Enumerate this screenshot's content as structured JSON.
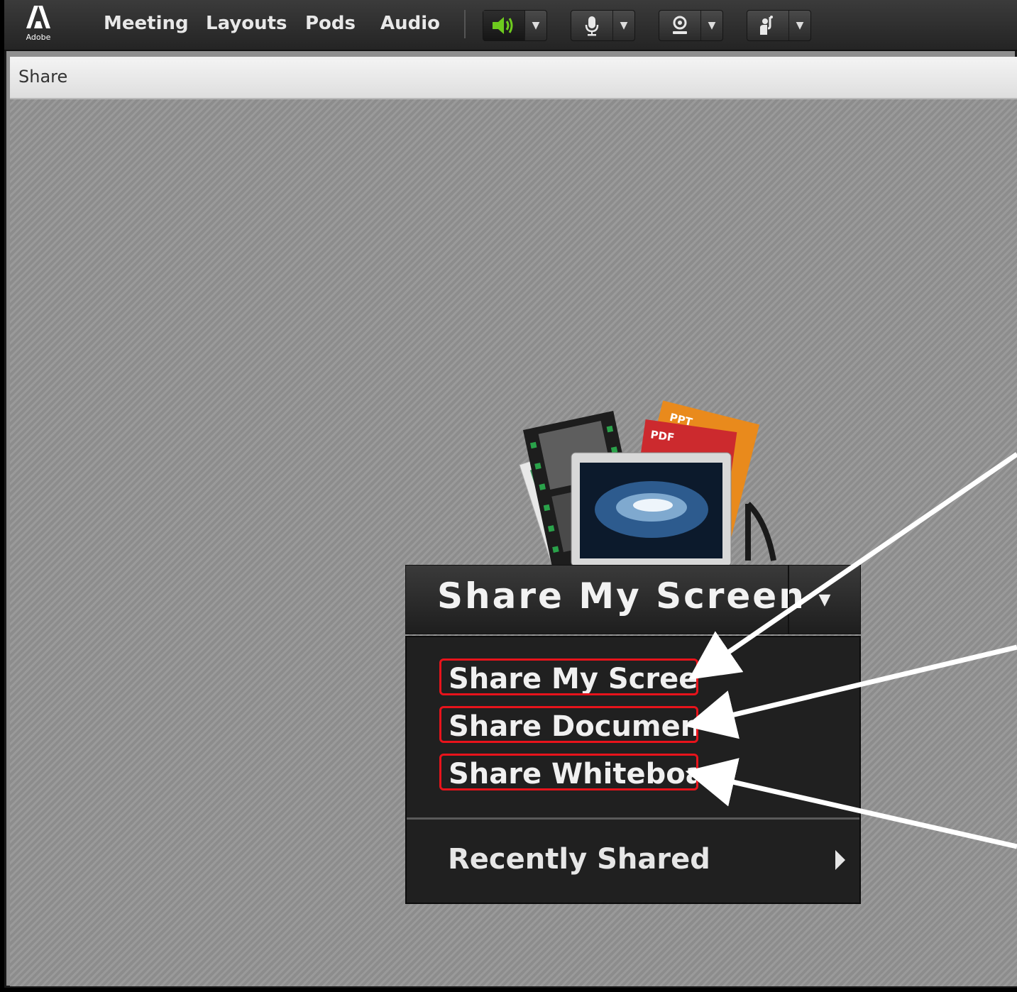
{
  "app": {
    "logo_text": "Adobe"
  },
  "menubar": {
    "items": [
      "Meeting",
      "Layouts",
      "Pods",
      "Audio"
    ],
    "tools": [
      {
        "icon": "speaker-icon",
        "active": true,
        "color": "#6ecb1e"
      },
      {
        "icon": "microphone-icon",
        "active": false
      },
      {
        "icon": "webcam-icon",
        "active": false
      },
      {
        "icon": "raise-hand-icon",
        "active": false
      }
    ]
  },
  "pod": {
    "title": "Share"
  },
  "share_button": {
    "label": "Share My Screen"
  },
  "dropdown": {
    "items": [
      "Share My Screen",
      "Share Document",
      "Share Whiteboard"
    ],
    "recent": "Recently Shared"
  },
  "media_icon": {
    "doc_labels": [
      "PPT",
      "PDF"
    ]
  },
  "colors": {
    "highlight": "#e8131b",
    "accent_green": "#6ecb1e"
  }
}
